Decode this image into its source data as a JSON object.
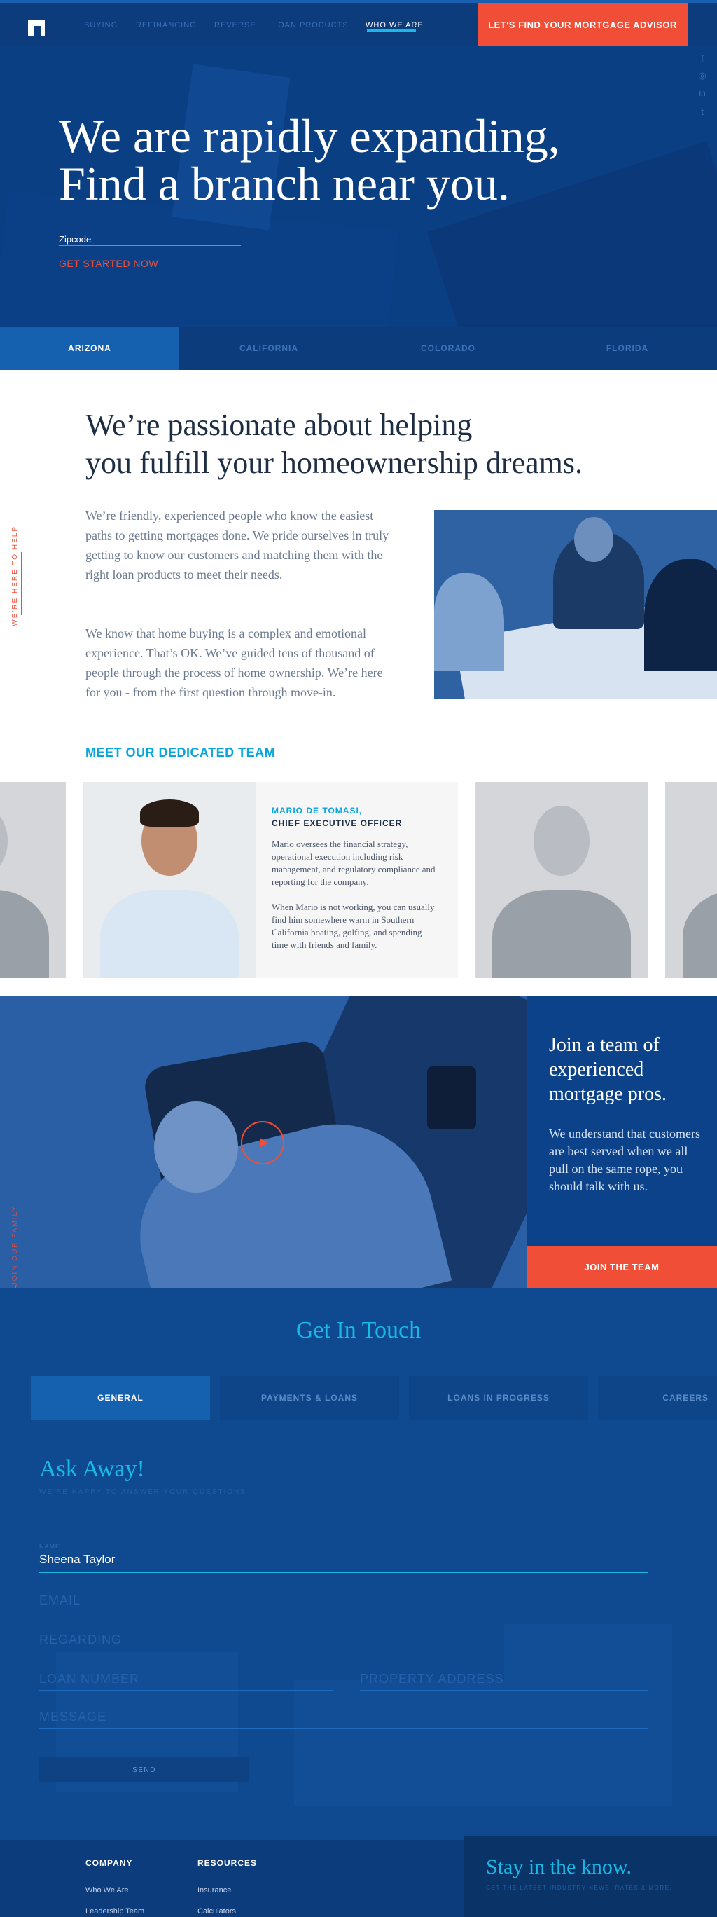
{
  "nav": {
    "items": [
      "BUYING",
      "REFINANCING",
      "REVERSE",
      "LOAN PRODUCTS",
      "WHO WE ARE"
    ],
    "active": "WHO WE ARE",
    "cta": "LET'S FIND YOUR MORTGAGE ADVISOR"
  },
  "social": {
    "facebook": "f",
    "instagram": "◎",
    "linkedin": "in",
    "twitter": "t"
  },
  "hero": {
    "title_line1": "We are rapidly expanding,",
    "title_line2": "Find a branch near you.",
    "zip_placeholder": "Zipcode",
    "get_started": "GET STARTED NOW"
  },
  "state_tabs": [
    "ARIZONA",
    "CALIFORNIA",
    "COLORADO",
    "FLORIDA"
  ],
  "intro": {
    "side_label": "WE'RE HERE TO HELP",
    "title_line1": "We’re  passionate about helping",
    "title_line2": "you fulfill your homeownership dreams.",
    "para1": "We’re friendly, experienced people who know the easiest paths to getting mortgages done. We pride ourselves in truly getting to know our customers and matching them with the right loan products to meet their needs.",
    "para2": "We know that home buying is a complex and emotional experience. That’s OK. We’ve guided tens of thousand of people through the process of home ownership. We’re here for you - from the first question through move-in.",
    "meet_team": "MEET OUR DEDICATED TEAM"
  },
  "featured_member": {
    "name": "MARIO DE TOMASI,",
    "role": "CHIEF EXECUTIVE OFFICER",
    "bio1": "Mario oversees the financial strategy, operational execution including risk management, and regulatory compliance and reporting for the company.",
    "bio2": "When Mario is not working, you can usually find him somewhere warm in Southern California boating, golfing, and spending time with friends and family."
  },
  "join": {
    "side_label": "JOIN OUR FAMILY",
    "title": "Join a team of experienced mortgage pros.",
    "text": "We understand that customers are best served when we all pull on the same rope, you should talk with us.",
    "button": "JOIN THE TEAM"
  },
  "contact": {
    "title": "Get In Touch",
    "tabs": [
      "GENERAL",
      "PAYMENTS & LOANS",
      "LOANS IN PROGRESS",
      "CAREERS"
    ],
    "ask_title": "Ask Away!",
    "ask_sub": "WE'RE HAPPY TO ANSWER YOUR QUESTIONS",
    "name_label": "NAME",
    "name_value": "Sheena Taylor",
    "email_placeholder": "EMAIL",
    "regarding_placeholder": "REGARDING",
    "loan_number_placeholder": "LOAN NUMBER",
    "property_address_placeholder": "PROPERTY ADDRESS",
    "message_placeholder": "MESSAGE",
    "send": "SEND"
  },
  "footer": {
    "company_heading": "COMPANY",
    "company_links": [
      "Who We Are",
      "Leadership Team"
    ],
    "resources_heading": "RESOURCES",
    "resources_links": [
      "Insurance",
      "Calculators"
    ],
    "newsletter_title": "Stay in the know.",
    "newsletter_sub": "GET THE LATEST INDUSTRY NEWS, RATES & MORE."
  },
  "colors": {
    "navy": "#0b3f84",
    "accent_orange": "#f04e36",
    "accent_cyan": "#18b9e6",
    "tab_active": "#1660b0"
  }
}
